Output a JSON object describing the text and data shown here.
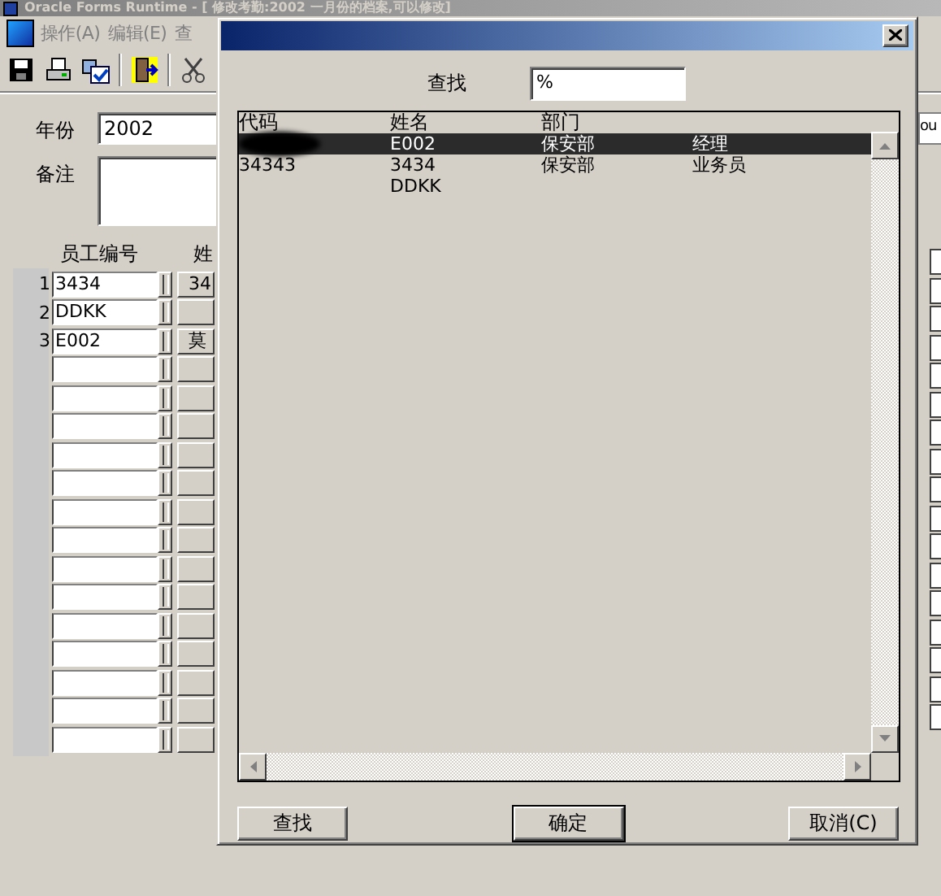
{
  "main_window": {
    "title": "Oracle Forms Runtime - [ 修改考勤:2002 一月份的档案,可以修改]",
    "menu": [
      "操作(A)",
      "编辑(E)",
      "查"
    ],
    "form": {
      "year_label": "年份",
      "year_value": "2002",
      "remarks_label": "备注",
      "column_1_header": "员工编号",
      "column_2_header": "姓",
      "right_field_value": "ou",
      "rows": [
        {
          "number": "1",
          "employee_id": "3434",
          "column_2": "34"
        },
        {
          "number": "2",
          "employee_id": "DDKK"
        },
        {
          "number": "3",
          "employee_id": "E002",
          "column_2": "莫"
        },
        {},
        {},
        {},
        {},
        {},
        {},
        {},
        {},
        {},
        {},
        {},
        {},
        {},
        {}
      ]
    }
  },
  "dialog": {
    "search_label": "查找",
    "search_value": "%",
    "columns": [
      "代码",
      "姓名",
      "部门"
    ],
    "rows": [
      {
        "code_redacted": true,
        "name": "E002",
        "department": "保安部",
        "column_4": "经理",
        "selected": true
      },
      {
        "code": "34343",
        "name": "3434",
        "department": "保安部",
        "column_4": "业务员",
        "selected": false
      },
      {
        "name": "DDKK",
        "selected": false
      }
    ],
    "buttons": [
      {
        "label": "查找",
        "default": false
      },
      {
        "label": "确定",
        "default": true
      },
      {
        "label": "取消(C)",
        "default": false
      }
    ]
  }
}
